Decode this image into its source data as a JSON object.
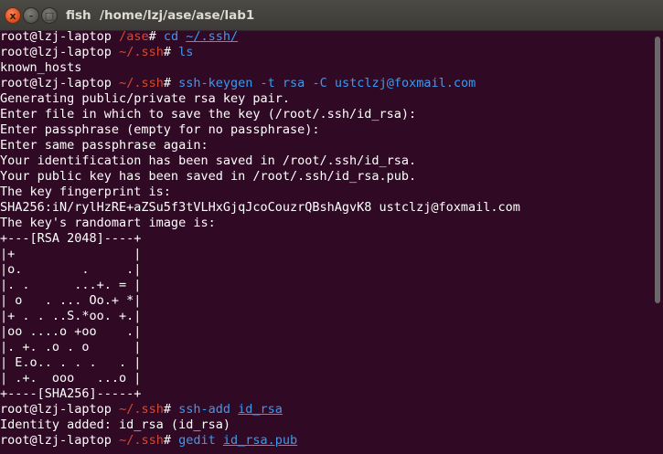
{
  "window": {
    "title": "fish  /home/lzj/ase/ase/lab1",
    "buttons": {
      "close": "x",
      "minimize": "-",
      "maximize": "□"
    }
  },
  "terminal": {
    "prompt_user": "root@lzj-laptop",
    "cmd1": {
      "cwd": "/ase",
      "hash": "#",
      "command": "cd",
      "arg": "~/.ssh/"
    },
    "cmd2": {
      "cwd": "~/.ssh",
      "hash": "#",
      "command": "ls"
    },
    "ls_output": "known_hosts",
    "cmd3": {
      "cwd": "~/.ssh",
      "hash": "#",
      "command": "ssh-keygen",
      "arg1": "-t rsa -C",
      "arg2": "ustclzj@foxmail.com"
    },
    "keygen_output": [
      "Generating public/private rsa key pair.",
      "Enter file in which to save the key (/root/.ssh/id_rsa):",
      "Enter passphrase (empty for no passphrase):",
      "Enter same passphrase again:",
      "Your identification has been saved in /root/.ssh/id_rsa.",
      "Your public key has been saved in /root/.ssh/id_rsa.pub.",
      "The key fingerprint is:",
      "SHA256:iN/rylHzRE+aZSu5f3tVLHxGjqJcoCouzrQBshAgvK8 ustclzj@foxmail.com",
      "The key's randomart image is:",
      "+---[RSA 2048]----+",
      "|+                |",
      "|o.        .     .|",
      "|. .      ...+. = |",
      "| o   . ... Oo.+ *|",
      "|+ . . ..S.*oo. +.|",
      "|oo ....o +oo    .|",
      "|. +. .o . o      |",
      "| E.o.. . . .   . |",
      "| .+.  ooo   ...o |",
      "+----[SHA256]-----+"
    ],
    "cmd4": {
      "cwd": "~/.ssh",
      "hash": "#",
      "command": "ssh-add",
      "arg": "id_rsa"
    },
    "ssh_add_output": "Identity added: id_rsa (id_rsa)",
    "cmd5": {
      "cwd": "~/.ssh",
      "hash": "#",
      "command": "gedit",
      "arg": "id_rsa.pub"
    }
  }
}
